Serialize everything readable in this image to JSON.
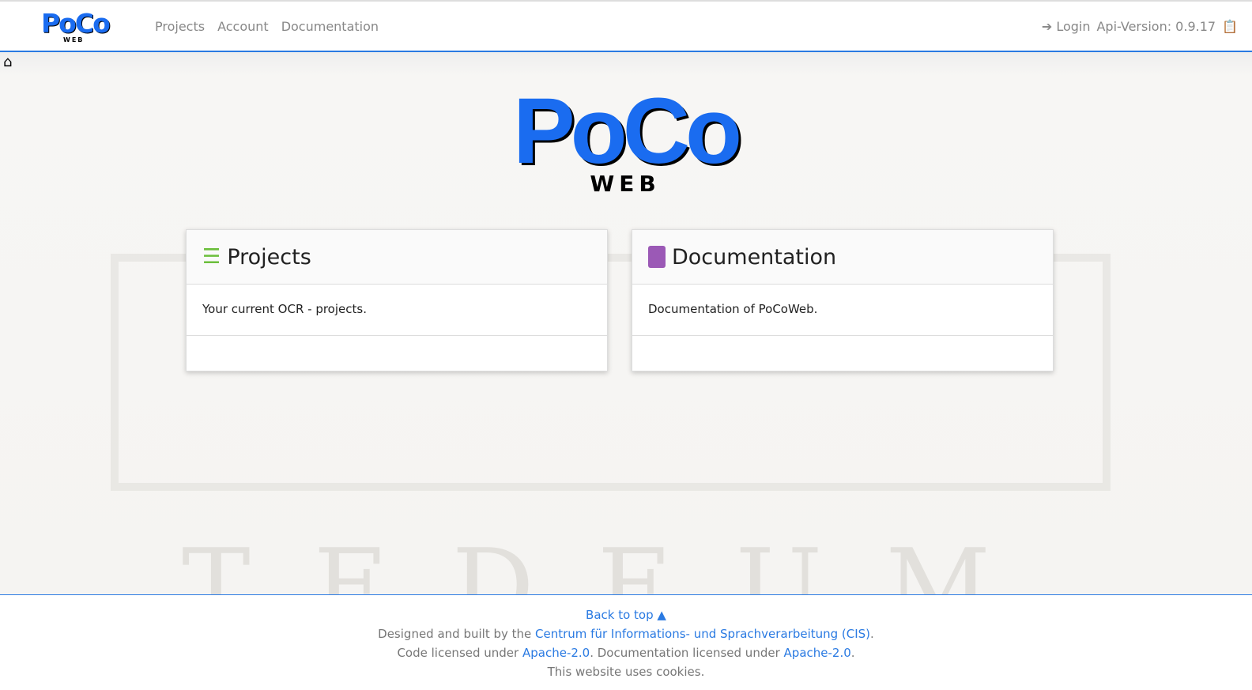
{
  "nav": {
    "logo": "PoCo",
    "logo_sub": "WEB",
    "links": [
      "Projects",
      "Account",
      "Documentation"
    ],
    "login": "Login",
    "api_version": "Api-Version: 0.9.17"
  },
  "hero": {
    "logo": "PoCo",
    "logo_sub": "WEB"
  },
  "cards": [
    {
      "title": "Projects",
      "body": "Your current OCR - projects.",
      "icon": "list-icon",
      "color": "#6cbf3c"
    },
    {
      "title": "Documentation",
      "body": "Documentation of PoCoWeb.",
      "icon": "book-icon",
      "color": "#9b59b6"
    }
  ],
  "footer": {
    "back_to_top": "Back to top",
    "designed": "Designed and built by the",
    "cis": "Centrum für Informations- und Sprachverarbeitung (CIS)",
    "code": "Code licensed under",
    "apache1": "Apache-2.0",
    "doc": ". Documentation licensed under",
    "apache2": "Apache-2.0",
    "cookies": "This website uses cookies."
  }
}
